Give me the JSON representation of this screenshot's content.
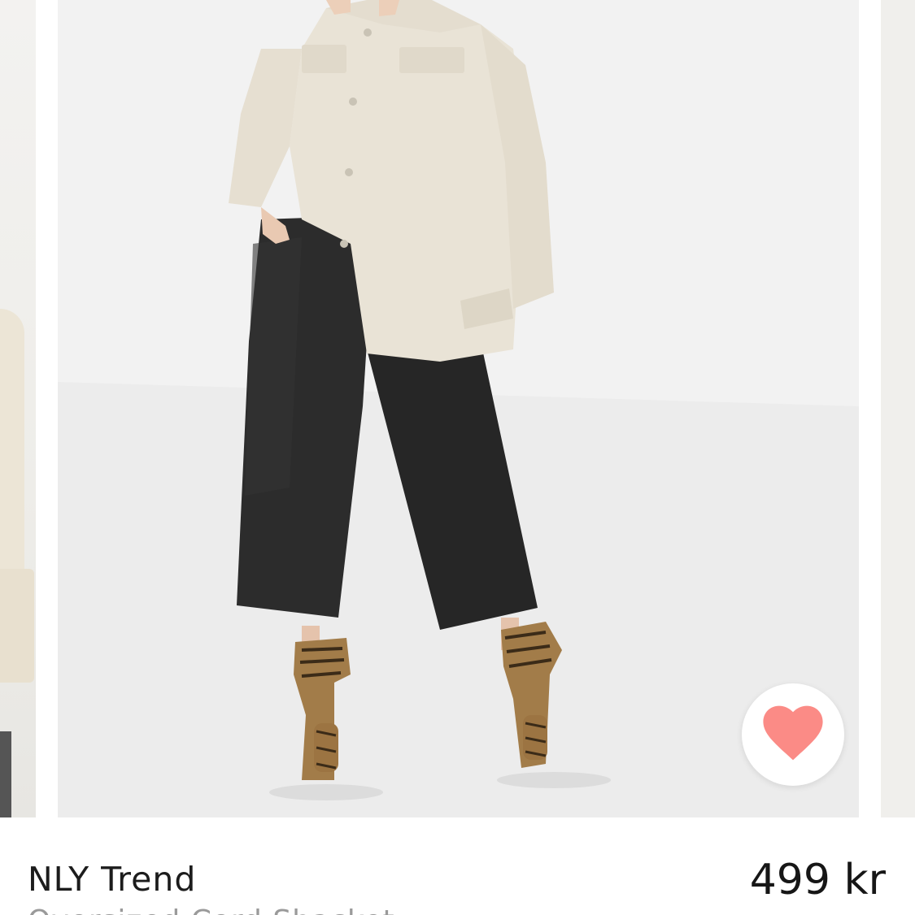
{
  "product": {
    "brand": "NLY Trend",
    "name": "Oversized Cord Shacket",
    "price": "499 kr",
    "favorite_icon": "heart-icon"
  },
  "colors": {
    "heart": "#fb8b86",
    "background": "#ffffff",
    "brand_text": "#1c1c1c",
    "name_text": "#9a9a9a"
  }
}
